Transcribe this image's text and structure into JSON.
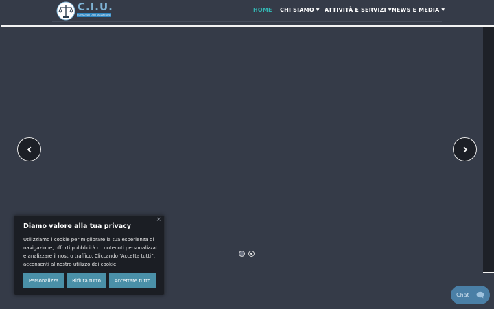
{
  "header": {
    "logo_title": "C.I.U.",
    "logo_subtitle": "CONSUMATORI ITALIANI UNITI",
    "nav": [
      {
        "label": "HOME",
        "active": true,
        "has_dropdown": false
      },
      {
        "label": "CHI SIAMO",
        "active": false,
        "has_dropdown": true
      },
      {
        "label": "ATTIVITÀ E SERVIZI",
        "active": false,
        "has_dropdown": true
      },
      {
        "label": "NEWS E MEDIA",
        "active": false,
        "has_dropdown": true
      }
    ]
  },
  "slider": {
    "prev_icon": "chevron-left-icon",
    "next_icon": "chevron-right-icon",
    "dots": 2,
    "active_dot": 2
  },
  "cookie": {
    "close": "×",
    "title": "Diamo valore alla tua privacy",
    "text": "Utilizziamo i cookie per migliorare la tua esperienza di navigazione, offrirti pubblicità o contenuti personalizzati e analizzare il nostro traffico. Cliccando “Accetta tutti”, acconsenti al nostro utilizzo dei cookie.",
    "buttons": {
      "customize": "Personalizza",
      "reject": "Rifiuta tutto",
      "accept": "Accettare tutto"
    }
  },
  "chat": {
    "label": "Chat",
    "icon": "chat-bubble-icon"
  },
  "colors": {
    "background": "#353b48",
    "accent": "#33b5b2",
    "button": "#4a90a8",
    "chat": "#4a7fa6"
  }
}
